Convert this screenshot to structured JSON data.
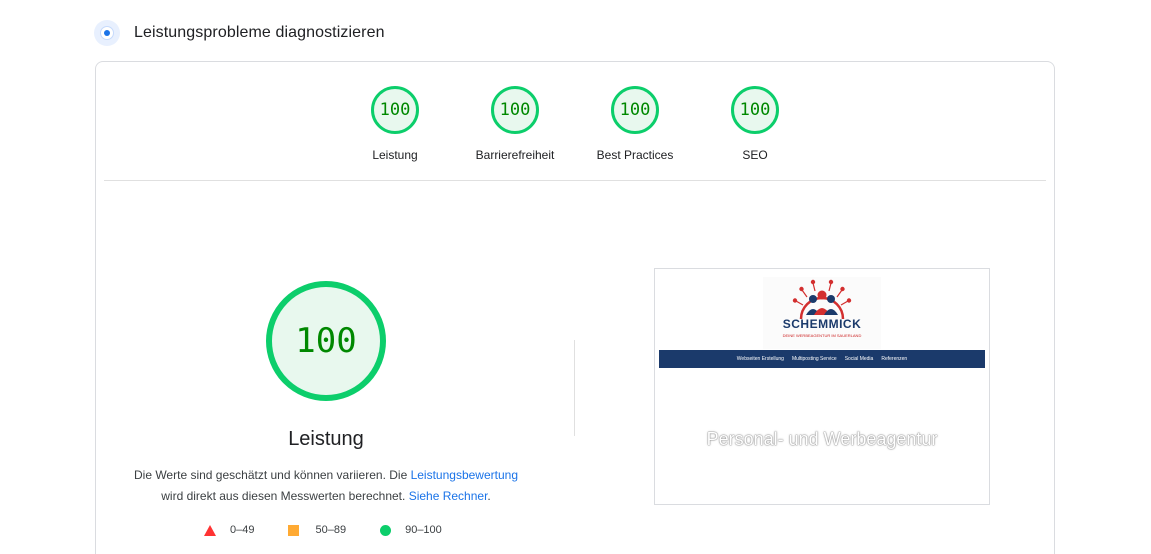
{
  "header": {
    "title": "Leistungsprobleme diagnostizieren",
    "icon": "lighthouse-icon"
  },
  "categories": [
    {
      "score": "100",
      "label": "Leistung"
    },
    {
      "score": "100",
      "label": "Barrierefreiheit"
    },
    {
      "score": "100",
      "label": "Best Practices"
    },
    {
      "score": "100",
      "label": "SEO"
    }
  ],
  "performance": {
    "score": "100",
    "title": "Leistung",
    "desc_part1": "Die Werte sind geschätzt und können variieren. Die ",
    "desc_link1": "Leistungsbewertung",
    "desc_part2": "wird direkt aus diesen Messwerten berechnet. ",
    "desc_link2": "Siehe Rechner",
    "desc_end": "."
  },
  "legend": [
    {
      "range": "0–49",
      "shape": "triangle",
      "color": "#ff3333"
    },
    {
      "range": "50–89",
      "shape": "square",
      "color": "#ffaa33"
    },
    {
      "range": "90–100",
      "shape": "circle",
      "color": "#0cce6b"
    }
  ],
  "screenshot": {
    "logo_text": "SCHEMMICK",
    "logo_tagline": "DEINE WERBEAGENTUR IM SAUERLAND",
    "nav_items": [
      "Webseiten Erstellung",
      "Multiposting Service",
      "Social Media",
      "Referenzen"
    ],
    "hero_text": "Personal- und Werbeagentur"
  },
  "colors": {
    "pass": "#0cce6b",
    "pass_text": "#008800",
    "link": "#1a73e8",
    "brand_navy": "#1b3a6b"
  }
}
